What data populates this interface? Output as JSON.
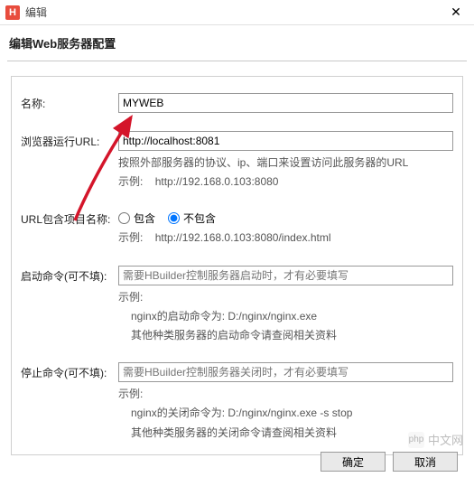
{
  "titlebar": {
    "icon_letter": "H",
    "title": "编辑"
  },
  "subtitle": "编辑Web服务器配置",
  "arrow_color": "#d4152a",
  "fields": {
    "name": {
      "label": "名称:",
      "value": "MYWEB"
    },
    "url": {
      "label": "浏览器运行URL:",
      "value": "http://localhost:8081",
      "help1": "按照外部服务器的协议、ip、端口来设置访问此服务器的URL",
      "help2_label": "示例:",
      "help2_value": "http://192.168.0.103:8080"
    },
    "include": {
      "label": "URL包含项目名称:",
      "option_include": "包含",
      "option_exclude": "不包含",
      "help_label": "示例:",
      "help_value": "http://192.168.0.103:8080/index.html"
    },
    "start_cmd": {
      "label": "启动命令(可不填):",
      "placeholder": "需要HBuilder控制服务器启动时，才有必要填写",
      "help_label": "示例:",
      "help_line1": "nginx的启动命令为:  D:/nginx/nginx.exe",
      "help_line2": "其他种类服务器的启动命令请查阅相关资料"
    },
    "stop_cmd": {
      "label": "停止命令(可不填):",
      "placeholder": "需要HBuilder控制服务器关闭时，才有必要填写",
      "help_label": "示例:",
      "help_line1": "nginx的关闭命令为:  D:/nginx/nginx.exe -s stop",
      "help_line2": "其他种类服务器的关闭命令请查阅相关资料"
    }
  },
  "buttons": {
    "ok": "确定",
    "cancel": "取消"
  },
  "watermark": {
    "icon": "php",
    "text": "中文网"
  }
}
